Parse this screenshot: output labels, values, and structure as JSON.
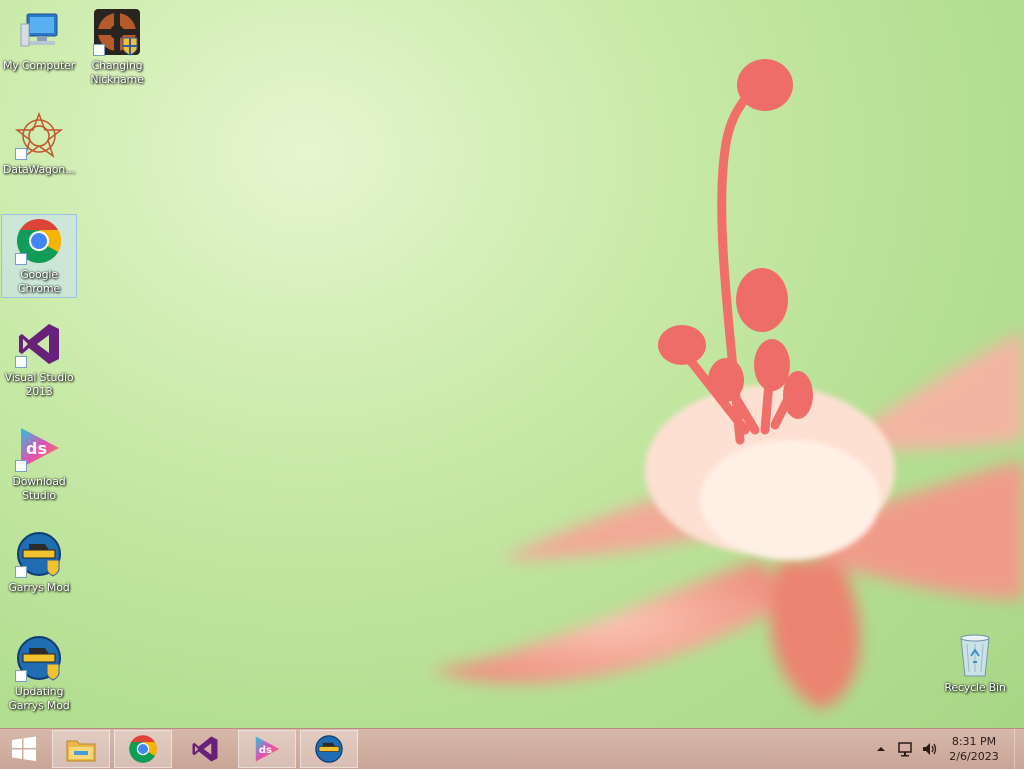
{
  "desktop": {
    "icons": [
      {
        "label": "My Computer",
        "icon": "computer-icon"
      },
      {
        "label": "Changing\nNickname",
        "icon": "tf2-icon"
      },
      {
        "label": "DataWagon...",
        "icon": "datawagon-icon"
      },
      {
        "label": "Google\nChrome",
        "icon": "chrome-icon"
      },
      {
        "label": "Visual Studio\n2013",
        "icon": "visual-studio-icon"
      },
      {
        "label": "Download\nStudio",
        "icon": "download-studio-icon"
      },
      {
        "label": "Garrys Mod",
        "icon": "garrys-mod-icon"
      },
      {
        "label": "Updating\nGarrys Mod",
        "icon": "garrys-mod-icon"
      },
      {
        "label": "Recycle Bin",
        "icon": "recycle-bin-icon"
      }
    ]
  },
  "taskbar": {
    "clock": {
      "time": "8:31 PM",
      "date": "2/6/2023"
    }
  }
}
